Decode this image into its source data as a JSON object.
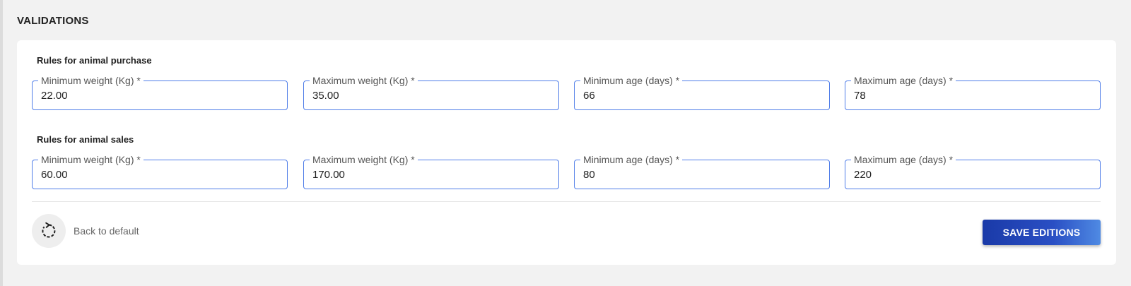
{
  "section_title": "VALIDATIONS",
  "purchase": {
    "title": "Rules for animal purchase",
    "fields": [
      {
        "label": "Minimum weight (Kg) *",
        "value": "22.00"
      },
      {
        "label": "Maximum weight (Kg) *",
        "value": "35.00"
      },
      {
        "label": "Minimum age (days) *",
        "value": "66"
      },
      {
        "label": "Maximum age (days) *",
        "value": "78"
      }
    ]
  },
  "sales": {
    "title": "Rules for animal sales",
    "fields": [
      {
        "label": "Minimum weight (Kg) *",
        "value": "60.00"
      },
      {
        "label": "Maximum weight (Kg) *",
        "value": "170.00"
      },
      {
        "label": "Minimum age (days) *",
        "value": "80"
      },
      {
        "label": "Maximum age (days) *",
        "value": "220"
      }
    ]
  },
  "actions": {
    "reset_icon": "reset-icon",
    "reset_label": "Back to default",
    "save_label": "SAVE EDITIONS"
  },
  "colors": {
    "field_border": "#4f7de8",
    "save_button_start": "#1a3aa8",
    "save_button_end": "#4f8ae3"
  }
}
